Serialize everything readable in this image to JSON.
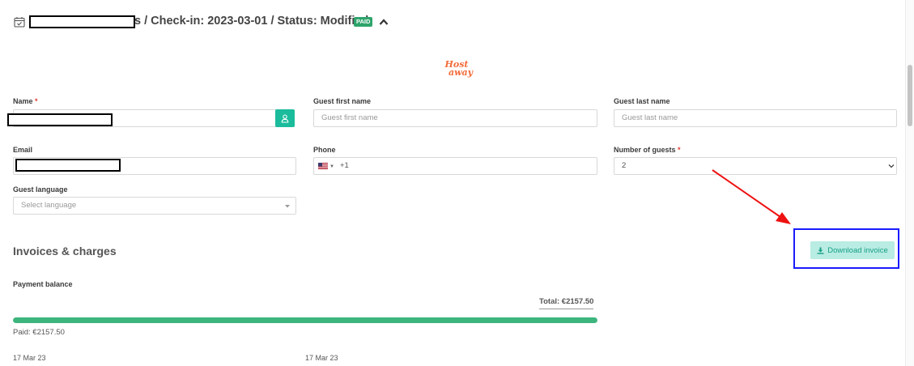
{
  "header": {
    "title": "s / Check-in: 2023-03-01 / Status: Modified",
    "badge": "PAID"
  },
  "logo": {
    "line1": "Host",
    "line2": "away"
  },
  "form": {
    "name": {
      "label": "Name",
      "required_mark": "*",
      "value": ""
    },
    "guest_first_name": {
      "label": "Guest first name",
      "placeholder": "Guest first name"
    },
    "guest_last_name": {
      "label": "Guest last name",
      "placeholder": "Guest last name"
    },
    "email": {
      "label": "Email",
      "value": ""
    },
    "phone": {
      "label": "Phone",
      "country_code": "+1"
    },
    "number_of_guests": {
      "label": "Number of guests",
      "required_mark": "*",
      "value": "2"
    },
    "guest_language": {
      "label": "Guest language",
      "placeholder": "Select language"
    }
  },
  "invoices": {
    "title": "Invoices & charges",
    "download_label": "Download invoice",
    "payment_balance_label": "Payment balance",
    "total": "Total: €2157.50",
    "paid": "Paid: €2157.50",
    "paid_fraction": 1.0,
    "date_left": "17 Mar 23",
    "date_right": "17 Mar 23"
  },
  "colors": {
    "accent": "#1abc9c",
    "paid_badge": "#2ea46b",
    "progress": "#3db57e",
    "annotation_box": "#1a1aff",
    "annotation_arrow": "#ee1111"
  }
}
